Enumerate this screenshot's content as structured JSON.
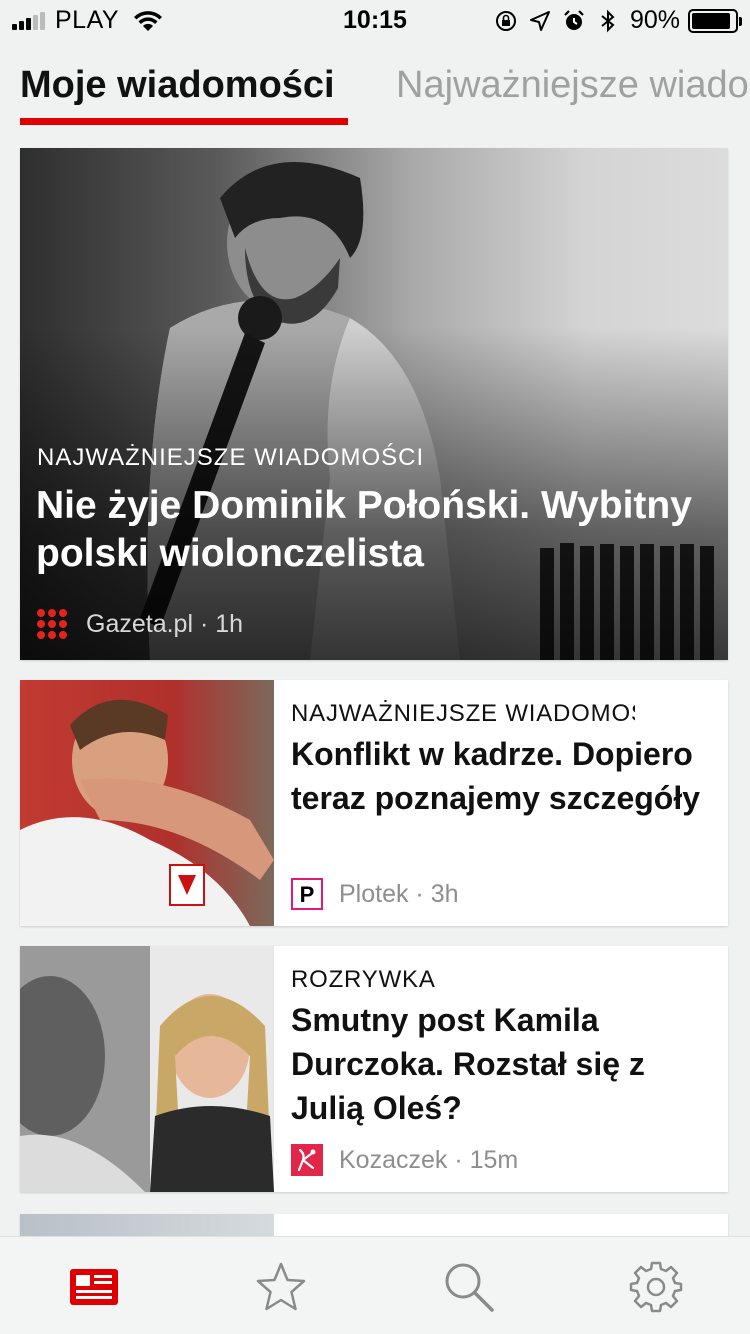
{
  "status_bar": {
    "carrier": "PLAY",
    "time": "10:15",
    "battery": "90%"
  },
  "tabs": [
    {
      "label": "Moje wiadomości",
      "active": true
    },
    {
      "label": "Najważniejsze wiadomości",
      "active": false
    }
  ],
  "hero": {
    "category": "NAJWAŻNIEJSZE WIADOMOŚCI",
    "title": "Nie żyje Dominik Połoński. Wybitny polski wiolonczelista",
    "source": "Gazeta.pl",
    "age": "1h",
    "source_icon": "gazeta-logo-icon"
  },
  "cards": [
    {
      "category": "NAJWAŻNIEJSZE WIADOMOŚCI",
      "title": "Konflikt w kadrze. Dopiero teraz poznajemy szczegóły",
      "source": "Plotek",
      "age": "3h",
      "source_icon": "plotek-logo-icon"
    },
    {
      "category": "ROZRYWKA",
      "title": "Smutny post Kamila Durczoka. Rozstał się z Julią Oleś?",
      "source": "Kozaczek",
      "age": "15m",
      "source_icon": "kozaczek-logo-icon"
    }
  ],
  "tabbar": [
    {
      "name": "news-icon",
      "active": true
    },
    {
      "name": "star-icon",
      "active": false
    },
    {
      "name": "search-icon",
      "active": false
    },
    {
      "name": "settings-icon",
      "active": false
    }
  ],
  "colors": {
    "accent": "#e00000",
    "inactive_tab": "#a0a0a0",
    "background": "#f0f1f1"
  }
}
